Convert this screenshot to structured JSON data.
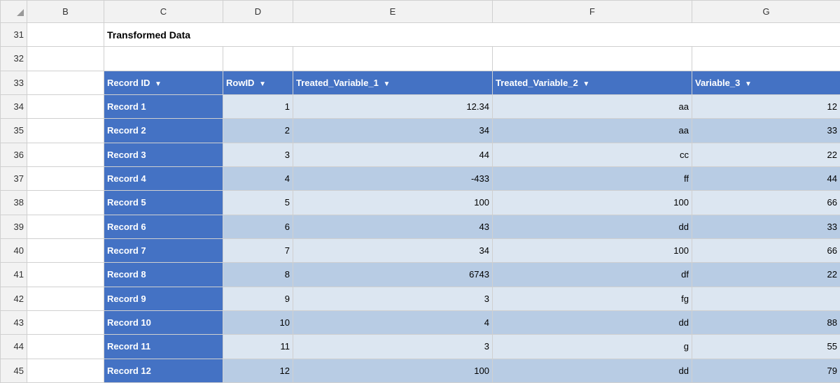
{
  "spreadsheet": {
    "columns": [
      "B",
      "C",
      "D",
      "E",
      "F",
      "G"
    ],
    "title": "Transformed Data",
    "title_row": 31,
    "table_header_row": 33,
    "headers": [
      {
        "label": "Record ID",
        "key": "record_id"
      },
      {
        "label": "RowID",
        "key": "row_id"
      },
      {
        "label": "Treated_Variable_1",
        "key": "tv1"
      },
      {
        "label": "Treated_Variable_2",
        "key": "tv2"
      },
      {
        "label": "Variable_3",
        "key": "v3"
      }
    ],
    "rows": [
      {
        "row_num": 34,
        "record_id": "Record 1",
        "row_id": "1",
        "tv1": "12.34",
        "tv2": "aa",
        "v3": "12"
      },
      {
        "row_num": 35,
        "record_id": "Record 2",
        "row_id": "2",
        "tv1": "34",
        "tv2": "aa",
        "v3": "33"
      },
      {
        "row_num": 36,
        "record_id": "Record 3",
        "row_id": "3",
        "tv1": "44",
        "tv2": "cc",
        "v3": "22"
      },
      {
        "row_num": 37,
        "record_id": "Record 4",
        "row_id": "4",
        "tv1": "-433",
        "tv2": "ff",
        "v3": "44"
      },
      {
        "row_num": 38,
        "record_id": "Record 5",
        "row_id": "5",
        "tv1": "100",
        "tv2": "100",
        "v3": "66"
      },
      {
        "row_num": 39,
        "record_id": "Record 6",
        "row_id": "6",
        "tv1": "43",
        "tv2": "dd",
        "v3": "33"
      },
      {
        "row_num": 40,
        "record_id": "Record 7",
        "row_id": "7",
        "tv1": "34",
        "tv2": "100",
        "v3": "66"
      },
      {
        "row_num": 41,
        "record_id": "Record 8",
        "row_id": "8",
        "tv1": "6743",
        "tv2": "df",
        "v3": "22"
      },
      {
        "row_num": 42,
        "record_id": "Record 9",
        "row_id": "9",
        "tv1": "3",
        "tv2": "fg",
        "v3": ""
      },
      {
        "row_num": 43,
        "record_id": "Record 10",
        "row_id": "10",
        "tv1": "4",
        "tv2": "dd",
        "v3": "88"
      },
      {
        "row_num": 44,
        "record_id": "Record 11",
        "row_id": "11",
        "tv1": "3",
        "tv2": "g",
        "v3": "55"
      },
      {
        "row_num": 45,
        "record_id": "Record 12",
        "row_id": "12",
        "tv1": "100",
        "tv2": "dd",
        "v3": "79"
      }
    ],
    "colors": {
      "header_bg": "#4472c4",
      "light_row": "#dce6f1",
      "dark_row": "#b8cce4",
      "col_header_bg": "#f2f2f2",
      "row_num_bg": "#f2f2f2"
    }
  }
}
